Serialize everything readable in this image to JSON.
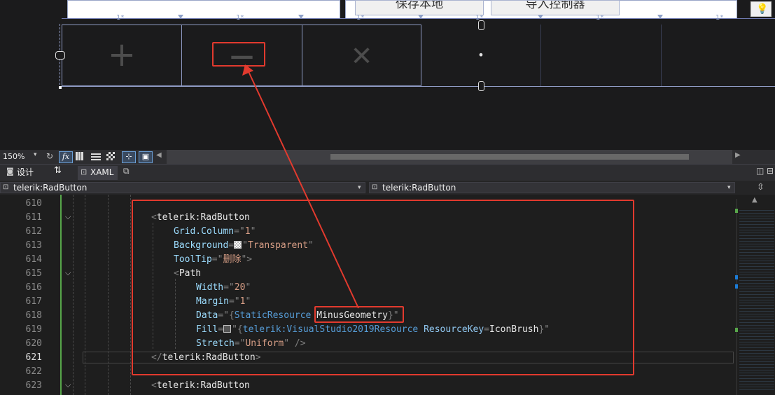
{
  "designer": {
    "top_buttons": [
      "保存本地",
      "导入控制器"
    ],
    "ruler_labels": [
      "1*",
      "1*",
      "1*",
      "1*",
      "1*",
      "1*"
    ],
    "cells": [
      {
        "icon": "plus-icon",
        "glyph": "+"
      },
      {
        "icon": "minus-icon",
        "glyph": "—"
      },
      {
        "icon": "close-icon",
        "glyph": "✕"
      },
      {
        "icon": "dot-icon",
        "glyph": "•"
      },
      {
        "icon": "",
        "glyph": ""
      },
      {
        "icon": "",
        "glyph": ""
      }
    ]
  },
  "toolbar": {
    "zoom": "150%",
    "fx_label": "fx"
  },
  "tabs": {
    "design": "设计",
    "swap": "⇅",
    "xaml": "XAML"
  },
  "nav": {
    "left_combo": "telerik:RadButton",
    "right_combo": "telerik:RadButton"
  },
  "editor": {
    "current_line": 621,
    "lines": [
      {
        "no": "610"
      },
      {
        "no": "611"
      },
      {
        "no": "612"
      },
      {
        "no": "613"
      },
      {
        "no": "614"
      },
      {
        "no": "615"
      },
      {
        "no": "616"
      },
      {
        "no": "617"
      },
      {
        "no": "618"
      },
      {
        "no": "619"
      },
      {
        "no": "620"
      },
      {
        "no": "621"
      },
      {
        "no": "622"
      },
      {
        "no": "623"
      }
    ],
    "code": {
      "l611_tag": "telerik:RadButton",
      "l612_attr": "Grid.Column",
      "l612_val": "1",
      "l613_attr": "Background",
      "l613_val": "Transparent",
      "l614_attr": "ToolTip",
      "l614_val": "删除",
      "l615_tag": "Path",
      "l616_attr": "Width",
      "l616_val": "20",
      "l617_attr": "Margin",
      "l617_val": "1",
      "l618_attr": "Data",
      "l618_res": "StaticResource",
      "l618_key": "MinusGeometry",
      "l619_attr": "Fill",
      "l619_res": "telerik:VisualStudio2019Resource",
      "l619_prop": "ResourceKey",
      "l619_val": "IconBrush",
      "l620_attr": "Stretch",
      "l620_val": "Uniform",
      "l621_tag": "telerik:RadButton",
      "l623_tag": "telerik:RadButton"
    }
  },
  "colors": {
    "annotation": "#e23a2e",
    "editor_bg": "#1e1e1e",
    "chrome": "#2d2d30"
  }
}
